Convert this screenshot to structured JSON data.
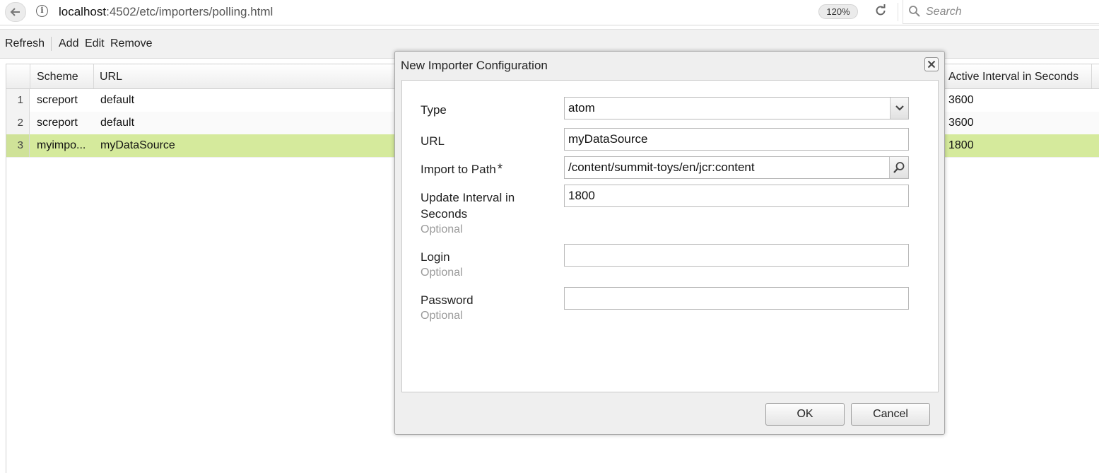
{
  "browser": {
    "url_host": "localhost",
    "url_rest": ":4502/etc/importers/polling.html",
    "zoom": "120%",
    "search_placeholder": "Search"
  },
  "toolbar": {
    "refresh": "Refresh",
    "add": "Add",
    "edit": "Edit",
    "remove": "Remove"
  },
  "grid": {
    "columns": {
      "scheme": "Scheme",
      "url": "URL",
      "interval": "Active Interval in Seconds"
    },
    "rows": [
      {
        "num": "1",
        "scheme": "screport",
        "url": "default",
        "interval": "3600"
      },
      {
        "num": "2",
        "scheme": "screport",
        "url": "default",
        "interval": "3600"
      },
      {
        "num": "3",
        "scheme": "myimpo...",
        "url": "myDataSource",
        "interval": "1800"
      }
    ]
  },
  "dialog": {
    "title": "New Importer Configuration",
    "type_label": "Type",
    "type_value": "atom",
    "url_label": "URL",
    "url_value": "myDataSource",
    "path_label": "Import to Path",
    "path_required": "*",
    "path_value": "/content/summit-toys/en/jcr:content",
    "interval_label_1": "Update Interval in",
    "interval_label_2": "Seconds",
    "interval_value": "1800",
    "login_label": "Login",
    "login_value": "",
    "password_label": "Password",
    "password_value": "",
    "optional": "Optional",
    "ok": "OK",
    "cancel": "Cancel"
  },
  "colors": {
    "selected_row": "#d5ea9c",
    "toolbar_bg": "#f1f1f1",
    "dialog_bg": "#efefef"
  },
  "icons": [
    "back-arrow-icon",
    "info-icon",
    "reload-icon",
    "search-icon",
    "close-icon",
    "chevron-down-icon",
    "magnifier-icon"
  ]
}
